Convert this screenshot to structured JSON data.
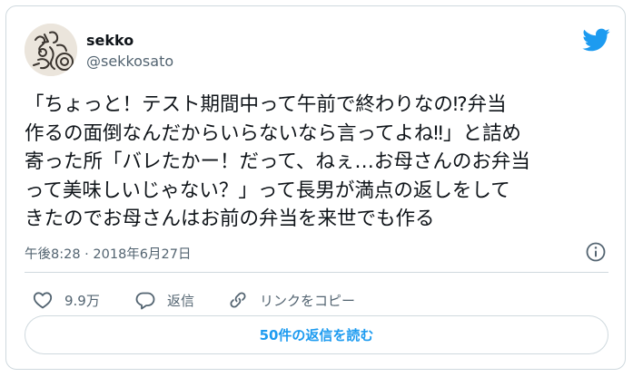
{
  "user": {
    "display_name": "sekko",
    "handle": "@sekkosato"
  },
  "tweet": {
    "lines": [
      "「ちょっと！テスト期間中って午前で終わりなの⁉弁当",
      "作るの面倒なんだからいらないなら言ってよね‼」と詰め",
      "寄った所「バレたかー！だって、ねぇ…お母さんのお弁当",
      "って美味しいじゃない？」って長男が満点の返しをして",
      "きたのでお母さんはお前の弁当を来世でも作る"
    ],
    "timestamp": "午後8:28 · 2018年6月27日"
  },
  "actions": {
    "like_count": "9.9万",
    "reply_label": "返信",
    "copy_link_label": "リンクをコピー"
  },
  "read_replies_label": "50件の返信を読む",
  "icons": {
    "brand": "twitter-bird-icon",
    "info": "info-icon",
    "like": "heart-icon",
    "reply": "speech-bubble-icon",
    "copy": "link-icon"
  },
  "colors": {
    "brand_blue": "#1d9bf0",
    "text_primary": "#0f1419",
    "text_secondary": "#536471",
    "border": "#cfd9de"
  }
}
